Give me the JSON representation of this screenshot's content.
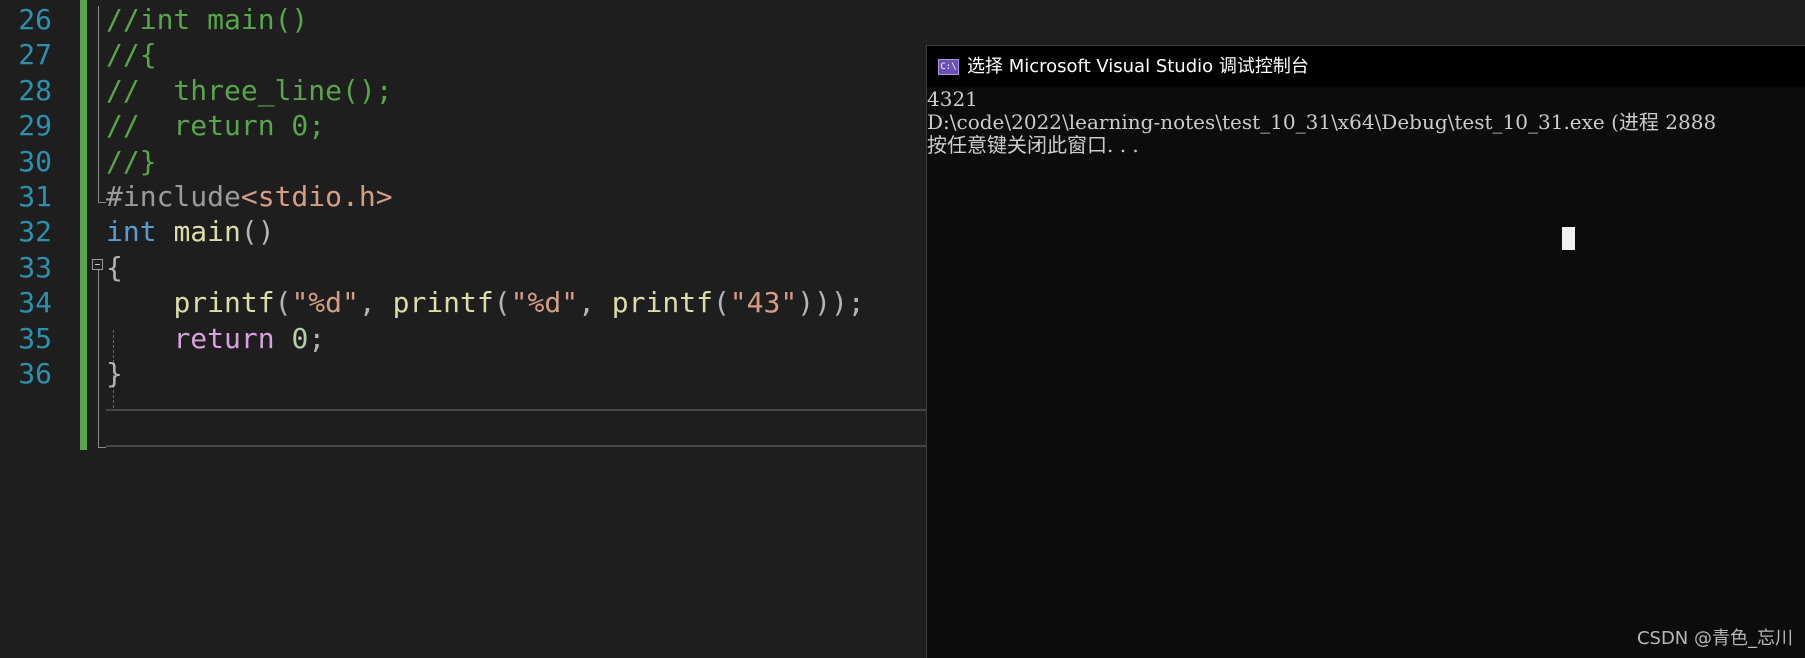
{
  "editor": {
    "line_numbers": [
      "26",
      "27",
      "28",
      "29",
      "30",
      "31",
      "32",
      "33",
      "34",
      "35",
      "36"
    ],
    "lines": {
      "l26": {
        "comment": "//int main()"
      },
      "l27": {
        "comment": "//{"
      },
      "l28": {
        "comment": "//  three_line();"
      },
      "l29": {
        "comment": "//  return 0;"
      },
      "l30": {
        "comment": "//}"
      },
      "l31": {
        "directive": "#include",
        "header": "<stdio.h>"
      },
      "l32": {
        "type": "int",
        "space": " ",
        "fn": "main",
        "parens": "()"
      },
      "l33": {
        "brace": "{"
      },
      "l34": {
        "indent": "    ",
        "fn1": "printf",
        "p1": "(",
        "s1": "\"%d\"",
        "c1": ", ",
        "fn2": "printf",
        "p2": "(",
        "s2": "\"%d\"",
        "c2": ", ",
        "fn3": "printf",
        "p3": "(",
        "s3": "\"43\"",
        "end": ")));"
      },
      "l35": {
        "indent": "    ",
        "kw": "return",
        "space": " ",
        "num": "0",
        "semi": ";"
      },
      "l36": {
        "brace": "}"
      }
    }
  },
  "console": {
    "icon": "C:\\",
    "title": "选择 Microsoft Visual Studio 调试控制台",
    "output": [
      "4321",
      "D:\\code\\2022\\learning-notes\\test_10_31\\x64\\Debug\\test_10_31.exe (进程 2888",
      "按任意键关闭此窗口. . ."
    ]
  },
  "watermark": "CSDN @青色_忘川",
  "colors": {
    "editor_background": "#1e1e1e",
    "line_number": "#2b91af",
    "comment": "#57a64a",
    "keyword": "#569cd6",
    "function": "#dcdcaa",
    "control_keyword": "#d8a0df",
    "string": "#d69d85",
    "number": "#b5cea8",
    "console_background": "#0c0c0c",
    "console_text": "#cccccc",
    "change_marker": "#57a64a"
  }
}
